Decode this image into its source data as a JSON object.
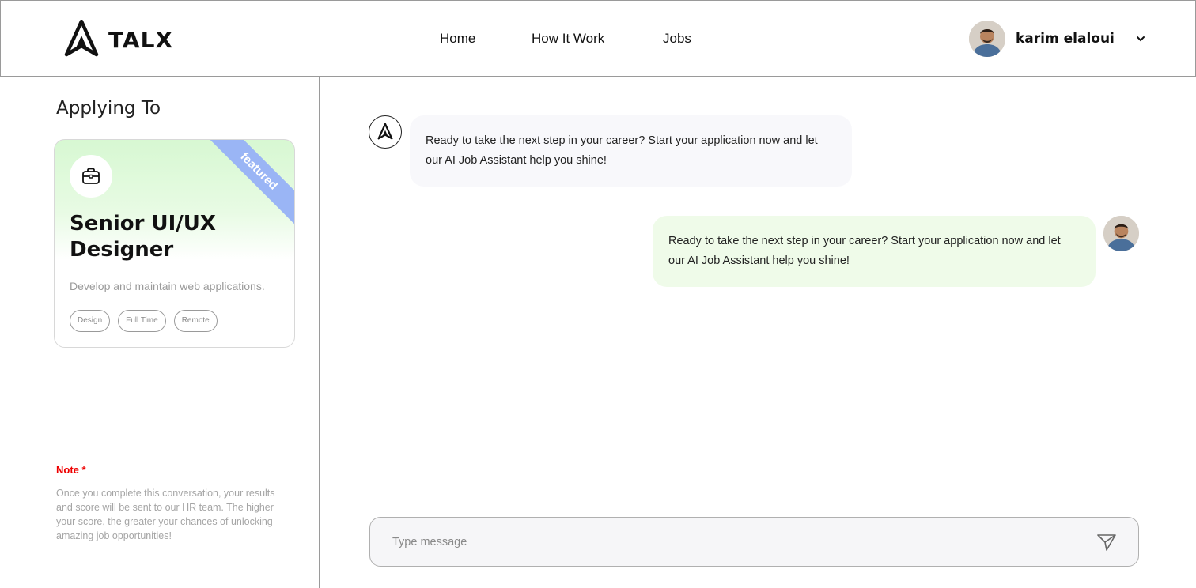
{
  "header": {
    "brand": "TALX",
    "nav": [
      {
        "label": "Home"
      },
      {
        "label": "How It Work"
      },
      {
        "label": "Jobs"
      }
    ],
    "user": {
      "name": "karim elaloui"
    }
  },
  "sidebar": {
    "heading": "Applying To",
    "card": {
      "ribbon": "featured",
      "title": "Senior UI/UX Designer",
      "description": "Develop and maintain web applications.",
      "tags": [
        "Design",
        "Full Time",
        "Remote"
      ]
    },
    "note": {
      "title": "Note *",
      "text": "Once you complete this conversation, your results and score will be sent to our HR team. The higher your score, the greater your chances of unlocking amazing job opportunities!"
    }
  },
  "chat": {
    "messages": [
      {
        "from": "assistant",
        "text": "Ready to take the next step in your career? Start your application now and let our AI Job Assistant help you shine!"
      },
      {
        "from": "user",
        "text": "Ready to take the next step in your career? Start your application now and let our AI Job Assistant help you shine!"
      }
    ],
    "input": {
      "placeholder": "Type message",
      "value": ""
    }
  },
  "colors": {
    "ribbon": "#9ab5f5",
    "card_gradient_top": "#d7f8d2",
    "user_bubble": "#effbe9",
    "bot_bubble": "#f8f8fb",
    "note_title": "#ee0000"
  },
  "icons": {
    "logo": "talx-logo-icon",
    "briefcase": "briefcase-icon",
    "chevron": "chevron-down-icon",
    "send": "send-icon"
  }
}
